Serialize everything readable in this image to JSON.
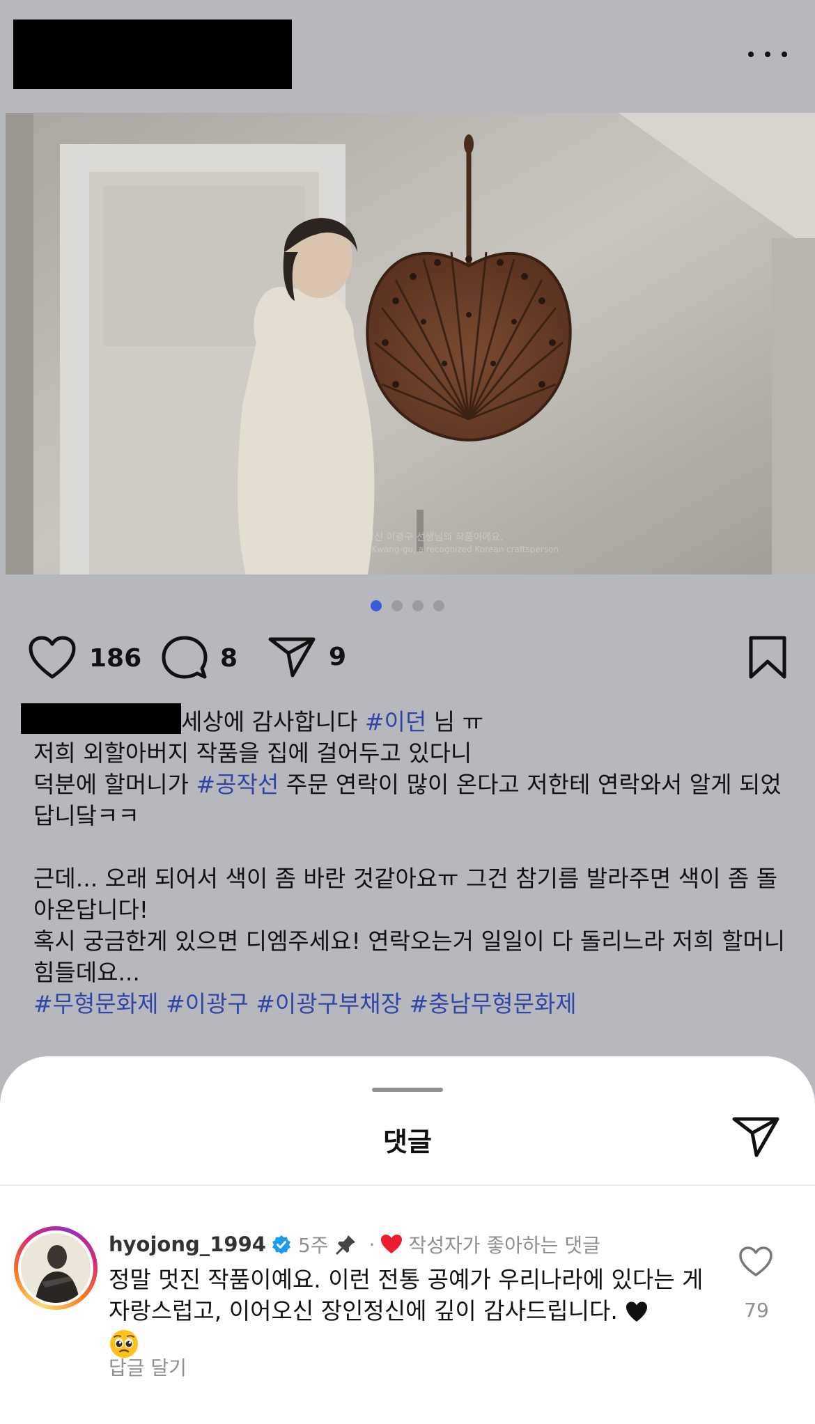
{
  "header": {
    "more_icon": "more-horizontal-icon"
  },
  "media": {
    "subtitle_ko": "정원 상생님이신 이광구 선생님의 작품이에요.",
    "subtitle_en": "It's a piece by Master Lee Kwang-gu, a recognized Korean craftsperson",
    "pager": {
      "total": 4,
      "active": 1
    }
  },
  "actions": {
    "likes": "186",
    "comments": "8",
    "shares": "9",
    "icons": [
      "heart-outline-icon",
      "comment-bubble-icon",
      "send-icon",
      "bookmark-icon"
    ]
  },
  "caption": {
    "line1_text": "세상에 감사합니다 ",
    "line1_tag": "#이던",
    "line1_end": " 님 ㅠ",
    "line2": " 저희 외할아버지 작품을 집에 걸어두고 있다니",
    "line3_pre": "덕분에 할머니가 ",
    "line3_tag": "#공작선",
    "line3_post": " 주문 연락이 많이 온다고 저한테 연락와서 알게 되었답니닼ㅋㅋ",
    "line4": "근데... 오래 되어서 색이 좀 바란 것같아요ㅠ 그건 참기름 발라주면 색이 좀 돌아온답니다!",
    "line5": "혹시 궁금한게 있으면 디엠주세요! 연락오는거 일일이 다 돌리느라 저희 할머니 힘들데요...",
    "hashtags": [
      "#무형문화제",
      "#이광구",
      "#이광구부채장",
      "#충남무형문화제"
    ]
  },
  "comments_sheet": {
    "title": "댓글",
    "comment": {
      "username": "hyojong_1994",
      "time": "5주",
      "separator": "·",
      "liked_by_author": "작성자가 좋아하는 댓글",
      "text": "정말 멋진 작품이예요. 이런 전통 공예가 우리나라에 있다는 게 자랑스럽고, 이어오신 장인정신에 깊이 감사드립니다.",
      "reply": "답글 달기",
      "like_count": "79"
    }
  },
  "colors": {
    "hashtag": "#3045a6",
    "pager_active": "#3b5bdb",
    "liked_heart": "#ed1c2e",
    "verified": "#1d9bf0"
  }
}
